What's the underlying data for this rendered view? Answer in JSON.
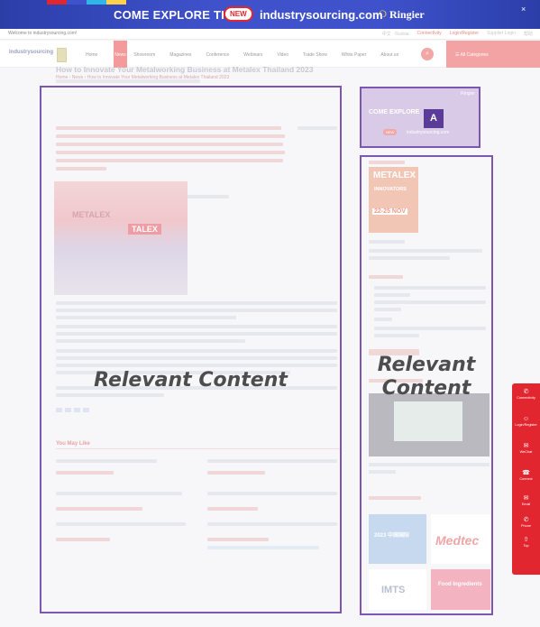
{
  "banner": {
    "text": "COME EXPLORE THE",
    "new_badge": "NEW",
    "site": "industrysourcing.com",
    "partner_mark": "❍",
    "partner": "Ringier",
    "close": "×",
    "stripe_colors": [
      "#e0262f",
      "#3f52cc",
      "#2fb5e8",
      "#ffd24a"
    ]
  },
  "util": {
    "welcome": "Welcome to industrysourcing.com!",
    "items": [
      "中文 · Russia",
      "Connectivity",
      "Login/Register",
      "Supplier Login",
      "帮助"
    ]
  },
  "nav": {
    "logo": "Industrysourcing",
    "items": [
      "Home",
      "Showroom",
      "Magazines",
      "Conference",
      "Webinars",
      "Video",
      "Trade Show",
      "White Paper",
      "About us"
    ],
    "active": "News",
    "search_icon": "⌕",
    "categories": "☰  All Categories"
  },
  "breadcrumb": "Home › News › How to Innovate Your Metalworking Business at Metalex Thailand 2023",
  "article": {
    "title": "How to Innovate Your Metalworking Business at Metalex Thailand 2023",
    "photo_sign_a": "METALEX",
    "photo_sign_b": "TALEX"
  },
  "may_like": "You May Like",
  "sidebar": {
    "ad_title": "COME EXPLORE",
    "ad_new": "NEW",
    "ad_site": "industrysourcing.com",
    "ad_partner": "Ringier",
    "metalex_a": "METALEX",
    "metalex_b": "INNOVATORS",
    "metalex_c": "22-25 NOV",
    "event_medtec": "Medtec",
    "event_imts": "IMTS",
    "event_1_text": "2023 中国国际",
    "event_4_text": "Food Ingredients"
  },
  "overlays": {
    "main_label": "Relevant Content",
    "side_label_1": "Relevant",
    "side_label_2": "Content",
    "badge": "A",
    "accent": "#7b57b0"
  },
  "floatbar": [
    {
      "icon": "✆",
      "label": "Connectivity"
    },
    {
      "icon": "☺",
      "label": "Login/Register"
    },
    {
      "icon": "✉",
      "label": "WeChat"
    },
    {
      "icon": "☎",
      "label": "Connect"
    },
    {
      "icon": "✉",
      "label": "Email"
    },
    {
      "icon": "✆",
      "label": "Phone"
    },
    {
      "icon": "⇧",
      "label": "Top"
    }
  ]
}
